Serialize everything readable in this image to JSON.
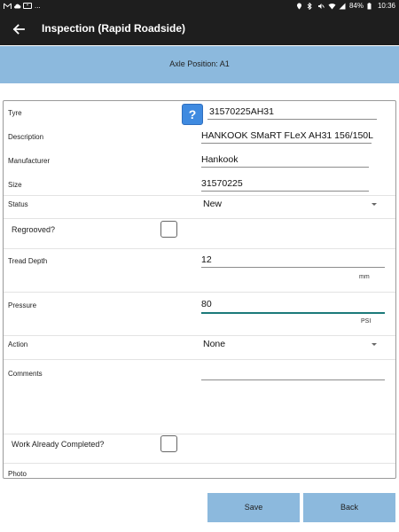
{
  "status_bar": {
    "notifications": "...",
    "battery": "84%",
    "time": "10:36"
  },
  "app_bar": {
    "title": "Inspection (Rapid Roadside)"
  },
  "banner": {
    "axle_position": "Axle Position: A1"
  },
  "form": {
    "tyre": {
      "label": "Tyre",
      "value": "31570225AH31"
    },
    "description": {
      "label": "Description",
      "value": "HANKOOK SMaRT FLeX AH31 156/150L"
    },
    "manufacturer": {
      "label": "Manufacturer",
      "value": "Hankook"
    },
    "size": {
      "label": "Size",
      "value": "31570225"
    },
    "status": {
      "label": "Status",
      "value": "New"
    },
    "regrooved": {
      "label": "Regrooved?"
    },
    "tread_depth": {
      "label": "Tread Depth",
      "value": "12",
      "unit": "mm"
    },
    "pressure": {
      "label": "Pressure",
      "value": "80",
      "unit": "PSI"
    },
    "action": {
      "label": "Action",
      "value": "None"
    },
    "comments": {
      "label": "Comments",
      "value": ""
    },
    "work_completed": {
      "label": "Work Already Completed?"
    },
    "photo": {
      "label": "Photo"
    }
  },
  "buttons": {
    "save": "Save",
    "back": "Back"
  },
  "colors": {
    "header_bg": "#1e1e1e",
    "accent_blue": "#8cb9dd",
    "help_button": "#3f8ae0",
    "active_underline": "#1b7a7a"
  }
}
